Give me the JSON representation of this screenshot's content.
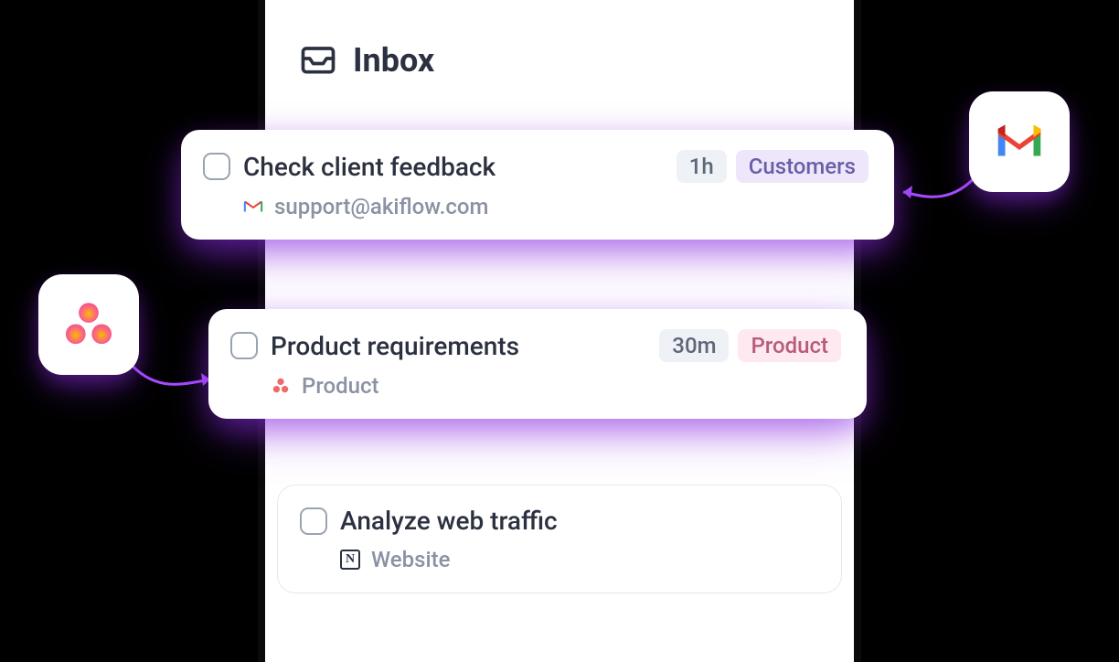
{
  "header": {
    "title": "Inbox"
  },
  "tasks": [
    {
      "title": "Check client feedback",
      "source_label": "support@akiflow.com",
      "source_icon": "gmail",
      "duration": "1h",
      "tag": {
        "label": "Customers",
        "style": "customers"
      }
    },
    {
      "title": "Product requirements",
      "source_label": "Product",
      "source_icon": "asana",
      "duration": "30m",
      "tag": {
        "label": "Product",
        "style": "product"
      }
    },
    {
      "title": "Analyze web traffic",
      "source_label": "Website",
      "source_icon": "notion",
      "duration": null,
      "tag": null
    }
  ],
  "integrations": {
    "gmail": "Gmail",
    "asana": "Asana"
  }
}
